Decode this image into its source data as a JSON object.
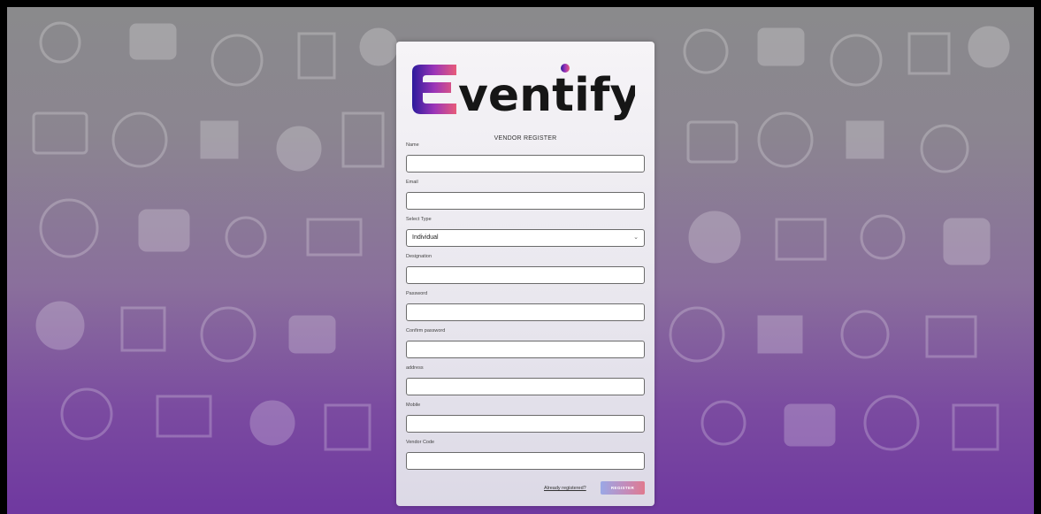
{
  "brand": {
    "logo_text": "ventify"
  },
  "form": {
    "title": "VENDOR REGISTER",
    "fields": [
      {
        "label": "Name",
        "value": ""
      },
      {
        "label": "Email",
        "value": ""
      },
      {
        "label": "Select Type",
        "value": "Individual"
      },
      {
        "label": "Designation",
        "value": ""
      },
      {
        "label": "Password",
        "value": ""
      },
      {
        "label": "Confirm password",
        "value": ""
      },
      {
        "label": "address",
        "value": ""
      },
      {
        "label": "Mobile",
        "value": ""
      },
      {
        "label": "Vendor Code",
        "value": ""
      }
    ],
    "login_link": "Already registered?",
    "submit_label": "REGISTER"
  },
  "colors": {
    "accent_purple": "#7b3fa0",
    "logo_dark": "#161616",
    "button_start": "#9aa8e6",
    "button_end": "#e07a8e"
  }
}
